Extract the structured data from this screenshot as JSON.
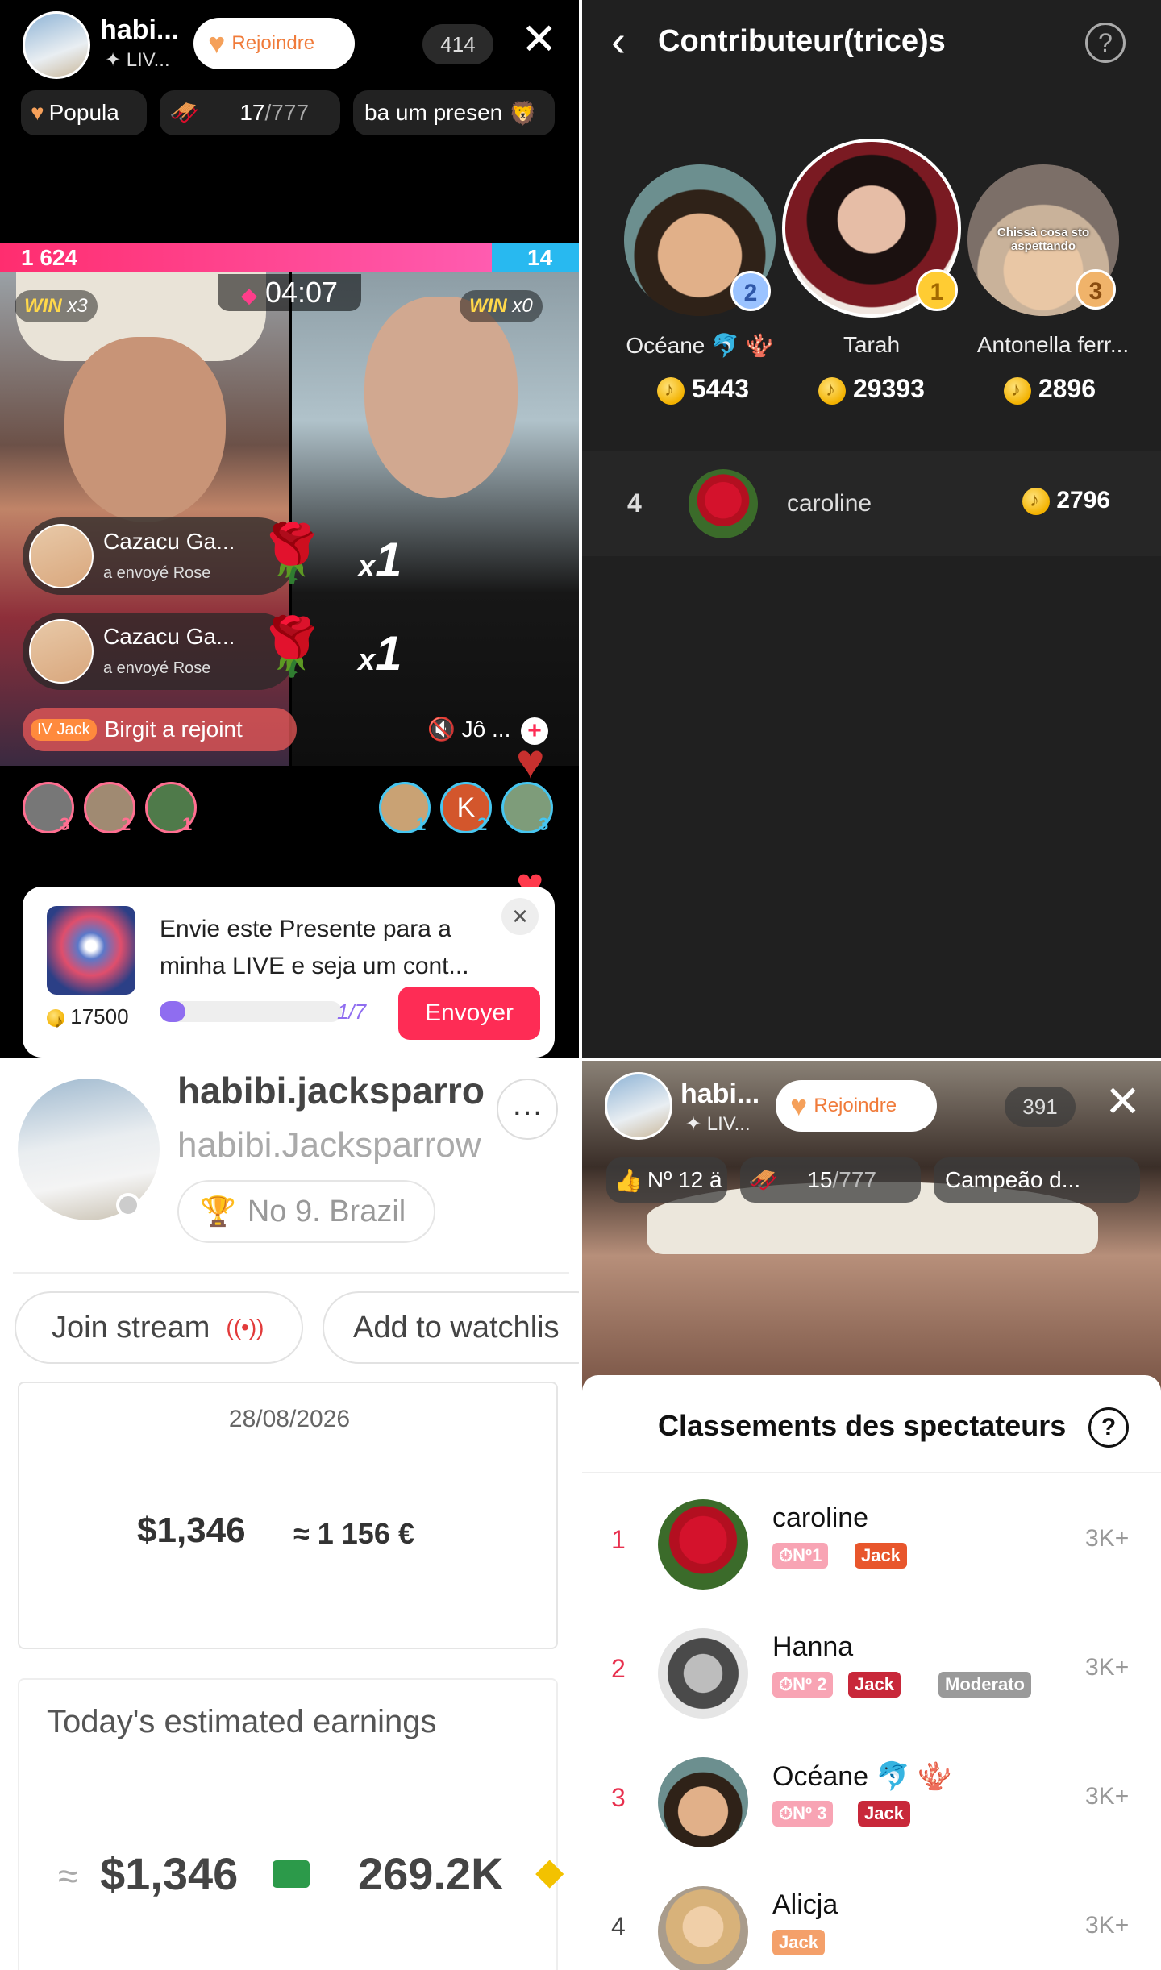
{
  "live_top": {
    "host_name": "habi...",
    "host_sub": "LIV...",
    "join_label": "Rejoindre",
    "viewers": "414",
    "chip1": "Popula",
    "chip2_count": "17",
    "chip2_total": "/777",
    "chip3": "ba um presen"
  },
  "battle": {
    "score_left": "1 624",
    "score_right": "14",
    "timer": "04:07",
    "win_left_label": "WIN",
    "win_left_count": "x3",
    "win_right_label": "WIN",
    "win_right_count": "x0",
    "left_score_fraction": 0.85
  },
  "gifts": [
    {
      "name": "Cazacu Ga...",
      "action": "a envoyé  Rose",
      "multiplier": "x",
      "count": "1"
    },
    {
      "name": "Cazacu Ga...",
      "action": "a envoyé  Rose",
      "multiplier": "x",
      "count": "1"
    }
  ],
  "join_notice": {
    "badge": "Jack",
    "text": "Birgit a rejoint"
  },
  "right_host": {
    "name": "Jô ..."
  },
  "left_supporters": [
    "3",
    "2",
    "1"
  ],
  "right_supporters": [
    {
      "letter": "",
      "rank": "1"
    },
    {
      "letter": "K",
      "rank": "2"
    },
    {
      "letter": "",
      "rank": "3"
    }
  ],
  "gift_prompt": {
    "text": "Envie este Presente para a minha LIVE e seja um cont...",
    "price": "17500",
    "progress_label": "1/7",
    "progress_fraction": 0.14,
    "button": "Envoyer"
  },
  "contributors": {
    "title": "Contributeur(trice)s",
    "podium": [
      {
        "rank": "2",
        "name": "Océane 🐬 🪸",
        "coins": "5443"
      },
      {
        "rank": "1",
        "name": "Tarah",
        "coins": "29393"
      },
      {
        "rank": "3",
        "name": "Antonella ferr...",
        "coins": "2896",
        "overlay": "Chissà cosa sto aspettando"
      }
    ],
    "list": [
      {
        "rank": "4",
        "name": "caroline",
        "coins": "2796"
      }
    ]
  },
  "profile": {
    "display_name": "habibi.jacksparro",
    "username": "habibi.Jacksparrow",
    "ranking": "No 9. Brazil",
    "join_stream": "Join stream",
    "add_watchlist": "Add to watchlis",
    "date": "28/08/2026",
    "earnings_usd": "$1,346",
    "earnings_eur": "≈ 1 156 €",
    "today_title": "Today's estimated earnings",
    "today_usd_prefix": "≈",
    "today_usd": "$1,346",
    "today_diamonds": "269.2K"
  },
  "live2": {
    "host_name": "habi...",
    "host_sub": "LIV...",
    "join_label": "Rejoindre",
    "viewers": "391",
    "chip1": "Nº 12 ä",
    "chip2_count": "15",
    "chip2_total": "/777",
    "chip3": "Campeão d..."
  },
  "viewer_ranking": {
    "title": "Classements des spectateurs",
    "rows": [
      {
        "rank": "1",
        "name": "caroline",
        "badges": [
          "Nº1",
          "Jack"
        ],
        "value": "3K+"
      },
      {
        "rank": "2",
        "name": "Hanna",
        "badges": [
          "Nº 2",
          "Jack",
          "Moderato"
        ],
        "value": "3K+"
      },
      {
        "rank": "3",
        "name": "Océane 🐬 🪸",
        "badges": [
          "Nº 3",
          "Jack"
        ],
        "value": "3K+"
      },
      {
        "rank": "4",
        "name": "Alicja",
        "badges": [
          "Jack"
        ],
        "value": "3K+"
      }
    ]
  },
  "colors": {
    "accent_pink": "#fe2c55",
    "rank_red": "#e8304e",
    "battle_pink": "#ff3d8b",
    "battle_blue": "#28b9f0",
    "coin_gold": "#f3b200"
  }
}
